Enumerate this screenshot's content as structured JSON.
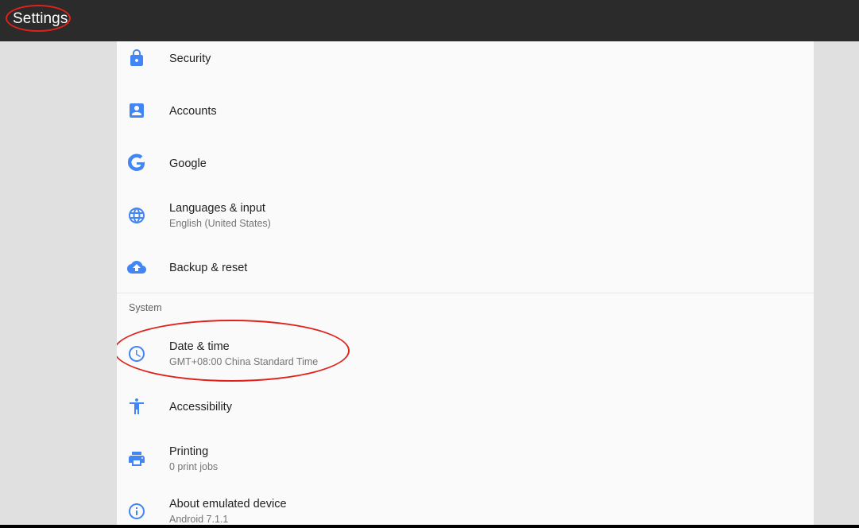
{
  "toolbar": {
    "title": "Settings"
  },
  "colors": {
    "toolbar_bg": "#2b2b2b",
    "accent": "#4285f4",
    "annotation_ring": "#e0221b"
  },
  "items": [
    {
      "label": "Security",
      "summary": null,
      "icon": "lock-icon"
    },
    {
      "label": "Accounts",
      "summary": null,
      "icon": "account-box-icon"
    },
    {
      "label": "Google",
      "summary": null,
      "icon": "google-g-icon"
    },
    {
      "label": "Languages & input",
      "summary": "English (United States)",
      "icon": "globe-icon"
    },
    {
      "label": "Backup & reset",
      "summary": null,
      "icon": "cloud-upload-icon"
    }
  ],
  "system_section": {
    "title": "System",
    "items": [
      {
        "label": "Date & time",
        "summary": "GMT+08:00 China Standard Time",
        "icon": "clock-icon"
      },
      {
        "label": "Accessibility",
        "summary": null,
        "icon": "accessibility-icon"
      },
      {
        "label": "Printing",
        "summary": "0 print jobs",
        "icon": "print-icon"
      },
      {
        "label": "About emulated device",
        "summary": "Android 7.1.1",
        "icon": "info-icon"
      }
    ]
  }
}
